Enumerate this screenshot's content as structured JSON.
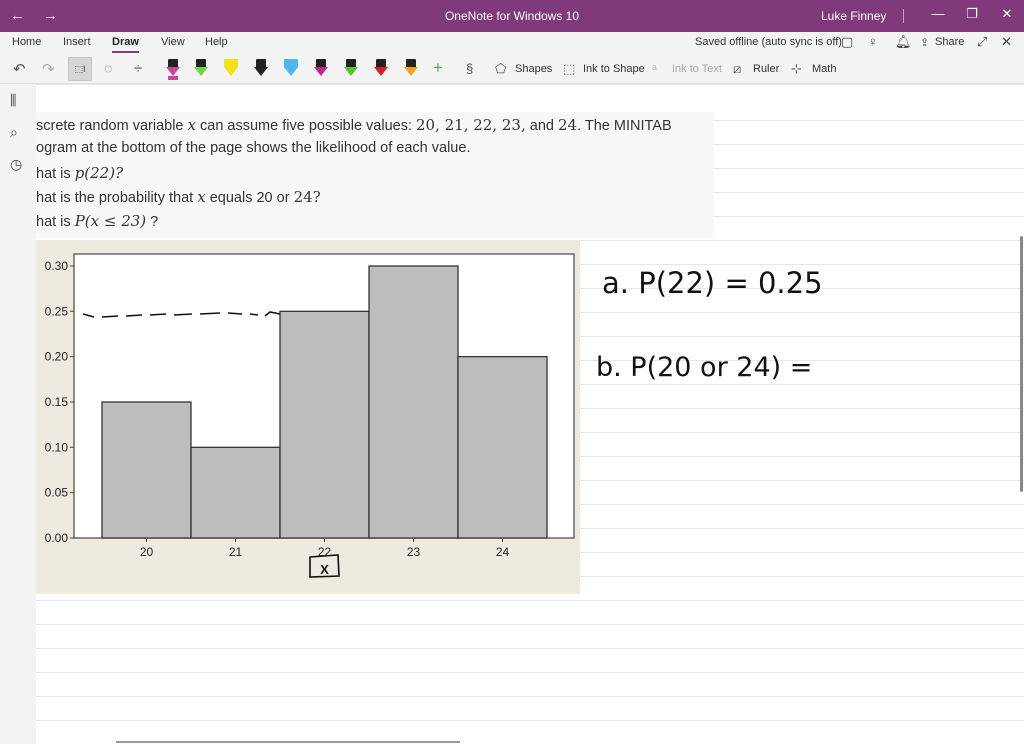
{
  "titlebar": {
    "back_icon": "←",
    "forward_icon": "→",
    "title": "OneNote for Windows 10",
    "user": "Luke Finney",
    "minimize_icon": "—",
    "restore_icon": "❐",
    "close_icon": "✕"
  },
  "tabs": {
    "items": [
      {
        "label": "Home"
      },
      {
        "label": "Insert"
      },
      {
        "label": "Draw"
      },
      {
        "label": "View"
      },
      {
        "label": "Help"
      }
    ],
    "active": "Draw",
    "status": "Saved offline (auto sync is off)",
    "share_label": "Share"
  },
  "toolbar": {
    "undo_icon": "↶",
    "redo_icon": "↷",
    "lasso_label": "⬚I",
    "add_space_icon": "÷",
    "add_pen_icon": "+",
    "shapes_label": "Shapes",
    "ink_to_shape_label": "Ink to Shape",
    "ink_to_text_label": "Ink to Text",
    "ruler_label": "Ruler",
    "math_label": "Math",
    "pens": [
      {
        "name": "pen-pink",
        "color": "#c6489a",
        "type": "marker"
      },
      {
        "name": "pen-green",
        "color": "#6bd63d",
        "type": "pen"
      },
      {
        "name": "highlighter-yellow",
        "color": "#f2e11b",
        "type": "highlighter"
      },
      {
        "name": "pen-black",
        "color": "#222222",
        "type": "pen"
      },
      {
        "name": "highlighter-blue",
        "color": "#4fb7ea",
        "type": "highlighter"
      },
      {
        "name": "pen-magenta",
        "color": "#c2238c",
        "type": "pen"
      },
      {
        "name": "pen-lime",
        "color": "#58c22a",
        "type": "pen"
      },
      {
        "name": "pen-red",
        "color": "#d71f1f",
        "type": "pen"
      },
      {
        "name": "pen-orange",
        "color": "#f0a41b",
        "type": "pen"
      }
    ]
  },
  "question": {
    "line1_text": "screte random variable ",
    "line1_var": "x",
    "line1_mid": " can assume five possible values: ",
    "line1_vals": "20, 21, 22, 23,",
    "line1_and": " and ",
    "line1_last": "24",
    "line1_end": ". The MINITAB",
    "line2": "ogram at the bottom of the page shows the likelihood of each value.",
    "line3_pre": "hat is ",
    "line3_math": "p(22)?",
    "line4_pre": "hat is the probability that ",
    "line4_var": "x",
    "line4_mid": " equals 20 or ",
    "line4_end": "24?",
    "line5_pre": "hat is ",
    "line5_math": "P(x ≤ 23)",
    "line5_end": " ?"
  },
  "chart_data": {
    "type": "bar",
    "categories": [
      "20",
      "21",
      "22",
      "23",
      "24"
    ],
    "values": [
      0.15,
      0.1,
      0.25,
      0.3,
      0.2
    ],
    "xlabel": "X",
    "ylabel": "",
    "ylim": [
      0,
      0.3
    ],
    "yticks": [
      "0.00",
      "0.05",
      "0.10",
      "0.15",
      "0.20",
      "0.25",
      "0.30"
    ],
    "grid": false,
    "bar_color": "#bdbdbd",
    "bar_edge": "#333333"
  },
  "ink": {
    "answer_a": "a. P(22) = 0.25",
    "answer_b": "b. P(20 or 24) ="
  }
}
